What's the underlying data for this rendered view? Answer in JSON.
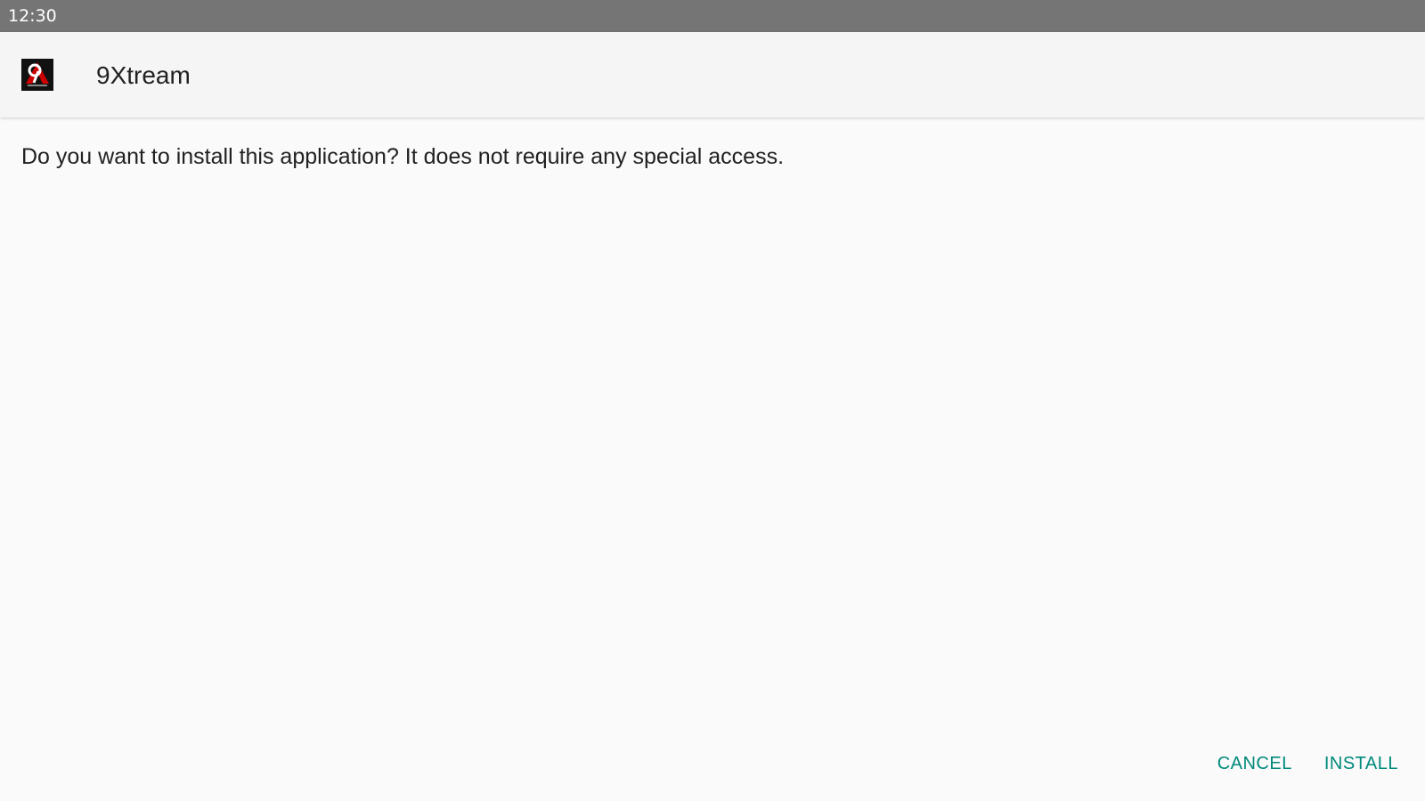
{
  "status_bar": {
    "time": "12:30"
  },
  "header": {
    "app_name": "9Xtream",
    "icon": "app-logo-icon"
  },
  "body": {
    "message": "Do you want to install this application? It does not require any special access."
  },
  "actions": {
    "cancel_label": "CANCEL",
    "install_label": "INSTALL"
  },
  "colors": {
    "status_bar": "#757575",
    "header_bg": "#f5f5f5",
    "page_bg": "#fafafa",
    "accent": "#00897b",
    "text": "#212121"
  }
}
